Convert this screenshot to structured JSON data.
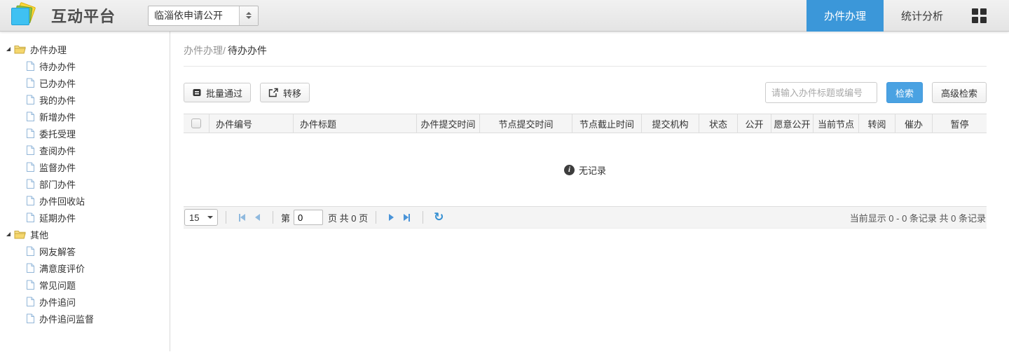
{
  "app": {
    "title": "互动平台"
  },
  "header": {
    "site_select": {
      "value": "临淄依申请公开"
    },
    "tabs": [
      {
        "label": "办件办理",
        "active": true
      },
      {
        "label": "统计分析",
        "active": false
      }
    ]
  },
  "sidebar": {
    "tree": [
      {
        "label": "办件办理",
        "children": [
          "待办办件",
          "已办办件",
          "我的办件",
          "新增办件",
          "委托受理",
          "查阅办件",
          "监督办件",
          "部门办件",
          "办件回收站",
          "延期办件"
        ]
      },
      {
        "label": "其他",
        "children": [
          "网友解答",
          "满意度评价",
          "常见问题",
          "办件追问",
          "办件追问监督"
        ]
      }
    ]
  },
  "main": {
    "breadcrumb": {
      "section": "办件办理/",
      "page": "待办办件"
    },
    "toolbar": {
      "batch_approve": "批量通过",
      "transfer": "转移"
    },
    "search": {
      "placeholder": "请输入办件标题或编号",
      "search_button": "检索",
      "advanced_button": "高级检索"
    },
    "table": {
      "columns": [
        "办件编号",
        "办件标题",
        "办件提交时间",
        "节点提交时间",
        "节点截止时间",
        "提交机构",
        "状态",
        "公开",
        "愿意公开",
        "当前节点",
        "转阅",
        "催办",
        "暂停"
      ],
      "empty_icon_glyph": "i",
      "empty_text": "无记录"
    },
    "pagination": {
      "page_size": "15",
      "label_page_prefix": "第",
      "page_value": "0",
      "label_page_suffix": "页 共 0 页",
      "refresh_glyph": "↻",
      "summary": "当前显示 0 - 0 条记录 共 0 条记录"
    }
  },
  "colors": {
    "accent_tab": "#3b97d9",
    "accent_button": "#4aa2e2",
    "pager_arrow": "#4a94d8"
  }
}
